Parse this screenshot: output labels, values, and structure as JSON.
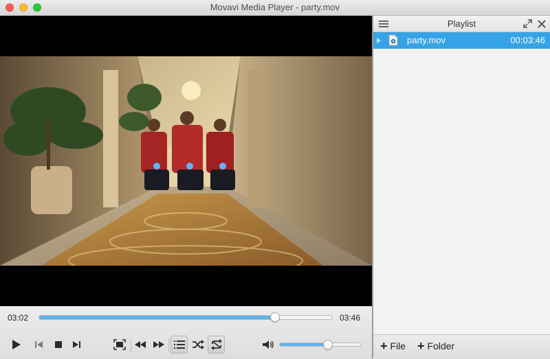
{
  "window": {
    "title": "Movavi Media Player - party.mov"
  },
  "player": {
    "current_time": "03:02",
    "total_time": "03:46",
    "progress": 0.805,
    "volume": 0.6
  },
  "playlist": {
    "title": "Playlist",
    "items": [
      {
        "name": "party.mov",
        "duration": "00:03:46",
        "selected": true
      }
    ],
    "add_file_label": "File",
    "add_folder_label": "Folder"
  },
  "colors": {
    "accent": "#36a3e6",
    "progress_fill": "#5fb3ec"
  },
  "icons": [
    "play-icon",
    "previous-icon",
    "stop-icon",
    "next-icon",
    "fullscreen-icon",
    "rewind-icon",
    "fast-forward-icon",
    "playlist-icon",
    "shuffle-icon",
    "repeat-icon",
    "volume-icon",
    "menu-icon",
    "expand-icon",
    "close-icon"
  ]
}
